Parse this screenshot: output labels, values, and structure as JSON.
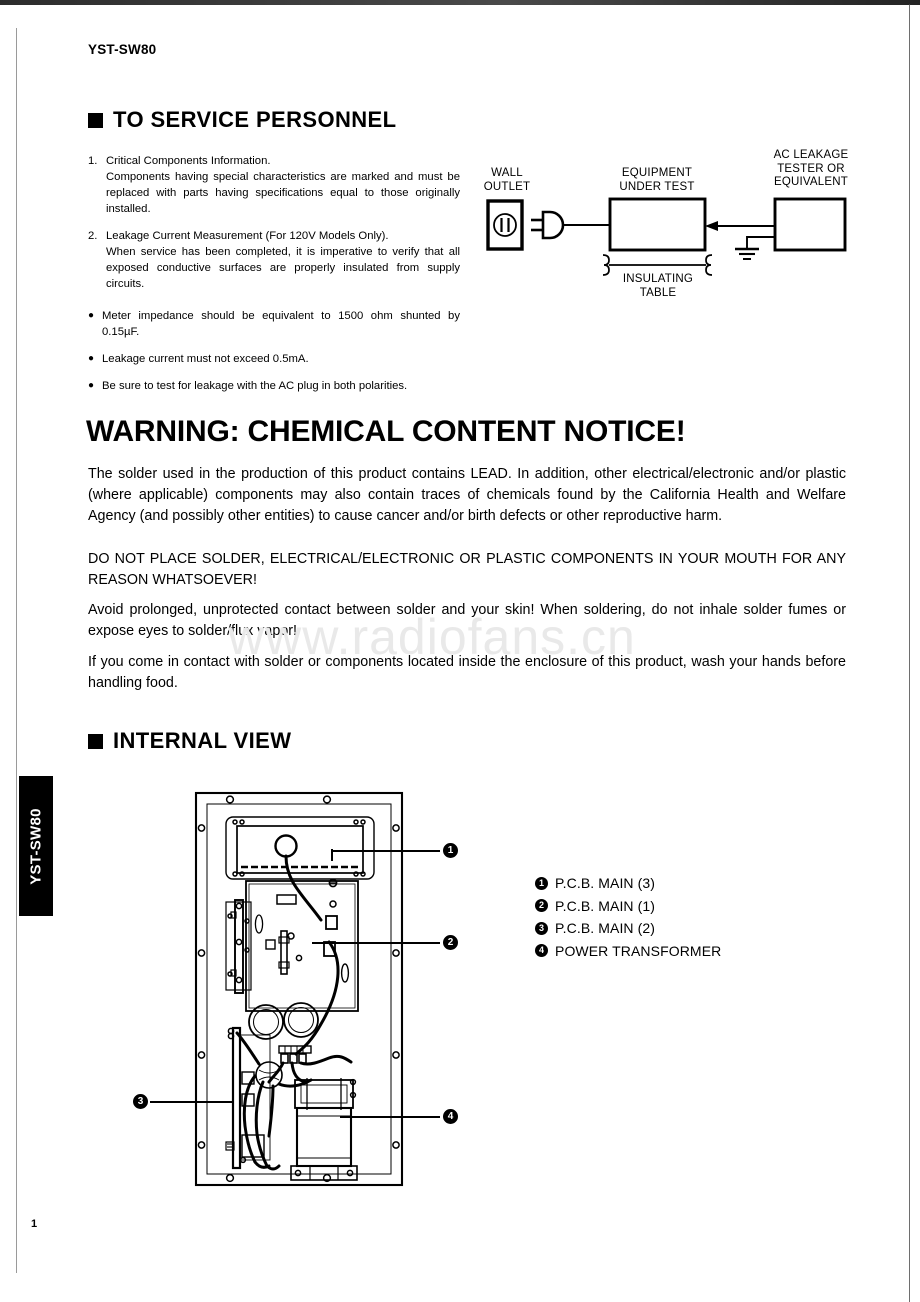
{
  "document": {
    "model": "YST-SW80",
    "side_tab": "YST-SW80",
    "page_number": "1",
    "watermark": "www.radiofans.cn"
  },
  "sections": {
    "service": {
      "heading": "TO SERVICE PERSONNEL",
      "items": [
        {
          "marker": "1.",
          "title": "Critical Components Information.",
          "body": "Components having special characteristics are marked and must be replaced with parts having specifications equal to those originally installed."
        },
        {
          "marker": "2.",
          "title": "Leakage Current Measurement (For 120V Models Only).",
          "body": "When service has been completed, it is imperative to verify that all exposed conductive surfaces are properly insulated from supply circuits."
        }
      ],
      "bullets": [
        "Meter impedance should be equivalent to 1500 ohm shunted by 0.15µF.",
        "Leakage current must not exceed 0.5mA.",
        "Be sure to test for leakage with the AC plug in both polarities."
      ]
    },
    "leakage_diagram": {
      "labels": {
        "wall_outlet": "WALL\nOUTLET",
        "equipment_under_test": "EQUIPMENT\nUNDER TEST",
        "ac_leakage_tester": "AC LEAKAGE\nTESTER OR\nEQUIVALENT",
        "insulating_table": "INSULATING\nTABLE"
      }
    },
    "warning": {
      "title": "WARNING: CHEMICAL CONTENT NOTICE!",
      "paragraphs": [
        "The solder used in the production of this product contains LEAD. In addition, other electrical/electronic and/or plastic (where applicable) components may also contain traces of chemicals found by the California Health and Welfare Agency (and possibly other entities) to cause cancer and/or birth defects or other reproductive harm.",
        "DO NOT PLACE SOLDER, ELECTRICAL/ELECTRONIC OR PLASTIC COMPONENTS IN YOUR MOUTH FOR ANY REASON WHATSOEVER!",
        "Avoid prolonged, unprotected contact between solder and your skin! When soldering, do not inhale solder fumes or expose eyes to solder/flux vapor!",
        "If you come in contact with solder or components located inside the enclosure of this product, wash your hands before handling food."
      ]
    },
    "internal_view": {
      "heading": "INTERNAL VIEW",
      "legend": [
        {
          "number": "1",
          "label": "P.C.B. MAIN (3)"
        },
        {
          "number": "2",
          "label": "P.C.B. MAIN (1)"
        },
        {
          "number": "3",
          "label": "P.C.B. MAIN (2)"
        },
        {
          "number": "4",
          "label": "POWER TRANSFORMER"
        }
      ],
      "callouts": [
        {
          "number": "1"
        },
        {
          "number": "2"
        },
        {
          "number": "3"
        },
        {
          "number": "4"
        }
      ]
    }
  },
  "colors": {
    "ink": "#000000",
    "watermark": "#e9e9e9",
    "scan_edge": "#1a1a1a"
  }
}
